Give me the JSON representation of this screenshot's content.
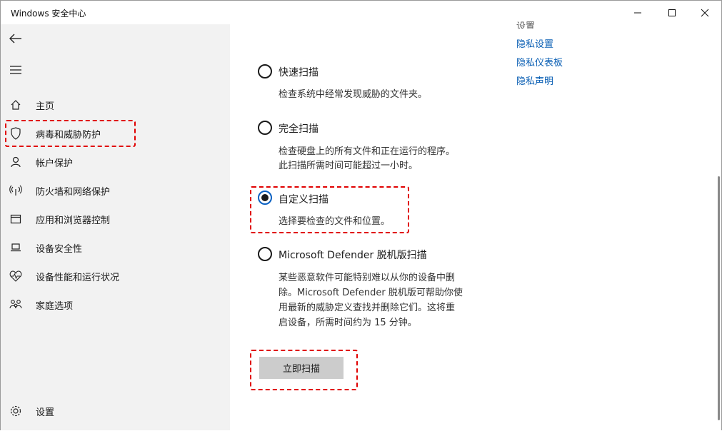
{
  "window": {
    "title": "Windows 安全中心"
  },
  "sidebar": {
    "items": [
      {
        "label": "主页",
        "icon": "home-icon"
      },
      {
        "label": "病毒和威胁防护",
        "icon": "shield-icon"
      },
      {
        "label": "帐户保护",
        "icon": "person-icon"
      },
      {
        "label": "防火墙和网络保护",
        "icon": "wifi-antenna-icon"
      },
      {
        "label": "应用和浏览器控制",
        "icon": "app-window-icon"
      },
      {
        "label": "设备安全性",
        "icon": "laptop-icon"
      },
      {
        "label": "设备性能和运行状况",
        "icon": "heart-pulse-icon"
      },
      {
        "label": "家庭选项",
        "icon": "family-icon"
      }
    ],
    "settings_label": "设置"
  },
  "scan_options": [
    {
      "label": "快速扫描",
      "description": [
        "检查系统中经常发现威胁的文件夹。"
      ],
      "selected": false
    },
    {
      "label": "完全扫描",
      "description": [
        "检查硬盘上的所有文件和正在运行的程序。",
        "此扫描所需时间可能超过一小时。"
      ],
      "selected": false
    },
    {
      "label": "自定义扫描",
      "description": [
        "选择要检查的文件和位置。"
      ],
      "selected": true
    },
    {
      "label": "Microsoft Defender 脱机版扫描",
      "description": [
        "某些恶意软件可能特别难以从你的设备中删",
        "除。Microsoft Defender 脱机版可帮助你使",
        "用最新的威胁定义查找并删除它们。这将重",
        "启设备，所需时间约为 15 分钟。"
      ],
      "selected": false
    }
  ],
  "scan_button_label": "立即扫描",
  "right_links": {
    "top_fragment": "设置",
    "items": [
      "隐私设置",
      "隐私仪表板",
      "隐私声明"
    ]
  },
  "colors": {
    "sidebar_bg": "#f2f2f2",
    "accent": "#0a5fb4",
    "highlight": "#e00000",
    "button_bg": "#cccccc"
  }
}
